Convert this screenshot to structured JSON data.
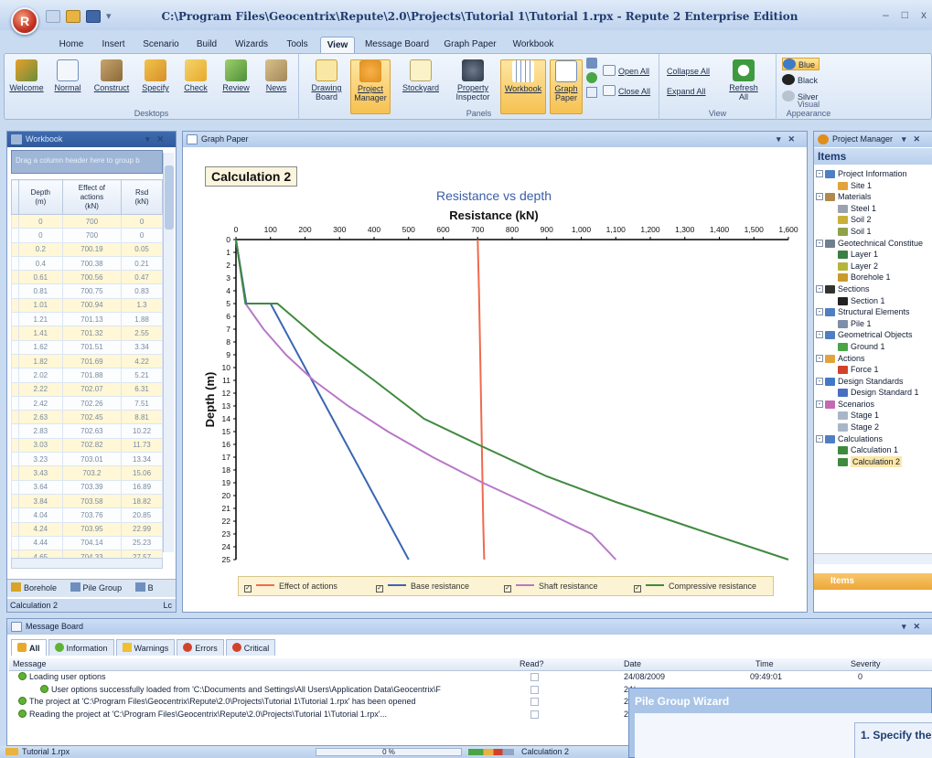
{
  "window": {
    "title": "C:\\Program Files\\Geocentrix\\Repute\\2.0\\Projects\\Tutorial 1\\Tutorial 1.rpx - Repute 2 Enterprise Edition",
    "controls": [
      "–",
      "□",
      "x"
    ]
  },
  "tabs": [
    "Home",
    "Insert",
    "Scenario",
    "Build",
    "Wizards",
    "Tools",
    "View",
    "Message Board",
    "Graph Paper",
    "Workbook"
  ],
  "active_tab": "View",
  "ribbon": {
    "desktops": {
      "label": "Desktops",
      "buttons": [
        "Welcome",
        "Normal",
        "Construct",
        "Specify",
        "Check",
        "Review",
        "News"
      ]
    },
    "panels": {
      "label": "Panels",
      "buttons": [
        {
          "l1": "Drawing",
          "l2": "Board"
        },
        {
          "l1": "Project",
          "l2": "Manager"
        },
        {
          "l1": "Stockyard",
          "l2": ""
        },
        {
          "l1": "Property",
          "l2": "Inspector"
        },
        {
          "l1": "Workbook",
          "l2": ""
        },
        {
          "l1": "Graph",
          "l2": "Paper"
        }
      ],
      "open_all": "Open All",
      "close_all": "Close All"
    },
    "view": {
      "label": "View",
      "collapse_all": "Collapse All",
      "expand_all": "Expand All",
      "refresh": {
        "l1": "Refresh",
        "l2": "All"
      }
    },
    "appearance": {
      "label": "Visual Appearance",
      "options": [
        "Blue",
        "Black",
        "Silver"
      ],
      "selected": "Blue"
    }
  },
  "workbook": {
    "title": "Workbook",
    "group_hint": "Drag a column header here to group b",
    "columns": [
      {
        "l1": "Depth",
        "l2": "(m)",
        "l3": ""
      },
      {
        "l1": "Effect of",
        "l2": "actions",
        "l3": "(kN)"
      },
      {
        "l1": "Rsd",
        "l2": "(kN)",
        "l3": ""
      }
    ],
    "rows": [
      [
        "0",
        "700",
        "0"
      ],
      [
        "0",
        "700",
        "0"
      ],
      [
        "0.2",
        "700.19",
        "0.05"
      ],
      [
        "0.4",
        "700.38",
        "0.21"
      ],
      [
        "0.61",
        "700.56",
        "0.47"
      ],
      [
        "0.81",
        "700.75",
        "0.83"
      ],
      [
        "1.01",
        "700.94",
        "1.3"
      ],
      [
        "1.21",
        "701.13",
        "1.88"
      ],
      [
        "1.41",
        "701.32",
        "2.55"
      ],
      [
        "1.62",
        "701.51",
        "3.34"
      ],
      [
        "1.82",
        "701.69",
        "4.22"
      ],
      [
        "2.02",
        "701.88",
        "5.21"
      ],
      [
        "2.22",
        "702.07",
        "6.31"
      ],
      [
        "2.42",
        "702.26",
        "7.51"
      ],
      [
        "2.63",
        "702.45",
        "8.81"
      ],
      [
        "2.83",
        "702.63",
        "10.22"
      ],
      [
        "3.03",
        "702.82",
        "11.73"
      ],
      [
        "3.23",
        "703.01",
        "13.34"
      ],
      [
        "3.43",
        "703.2",
        "15.06"
      ],
      [
        "3.64",
        "703.39",
        "16.89"
      ],
      [
        "3.84",
        "703.58",
        "18.82"
      ],
      [
        "4.04",
        "703.76",
        "20.85"
      ],
      [
        "4.24",
        "703.95",
        "22.99"
      ],
      [
        "4.44",
        "704.14",
        "25.23"
      ],
      [
        "4.65",
        "704.33",
        "27.57"
      ]
    ],
    "bottom_tabs": [
      "Borehole",
      "Pile Group",
      "B"
    ],
    "status_left": "Calculation 2",
    "status_right": "Lc"
  },
  "graph_paper": {
    "title": "Graph Paper",
    "calc_label": "Calculation 2"
  },
  "chart_data": {
    "type": "line",
    "title": "Resistance vs depth",
    "xlabel": "Resistance (kN)",
    "ylabel": "Depth (m)",
    "xlim": [
      0,
      1600
    ],
    "ylim": [
      0,
      25
    ],
    "y_inverted": true,
    "x_ticks": [
      "0",
      "100",
      "200",
      "300",
      "400",
      "500",
      "600",
      "700",
      "800",
      "900",
      "1,000",
      "1,100",
      "1,200",
      "1,300",
      "1,400",
      "1,500",
      "1,600"
    ],
    "y_ticks": [
      0,
      1,
      2,
      3,
      4,
      5,
      6,
      7,
      8,
      9,
      10,
      11,
      12,
      13,
      14,
      15,
      16,
      17,
      18,
      19,
      20,
      21,
      22,
      23,
      24,
      25
    ],
    "legend_position": "bottom",
    "series": [
      {
        "name": "Effect of actions",
        "color": "#f06a4e",
        "points": [
          [
            700,
            0
          ],
          [
            703.8,
            4
          ],
          [
            708,
            10
          ],
          [
            712,
            16
          ],
          [
            716,
            22
          ],
          [
            719,
            25
          ]
        ]
      },
      {
        "name": "Base resistance",
        "color": "#3a67b2",
        "points": [
          [
            0,
            0
          ],
          [
            30,
            5
          ],
          [
            100,
            5
          ],
          [
            200,
            10
          ],
          [
            300,
            15
          ],
          [
            400,
            20
          ],
          [
            500,
            25
          ]
        ]
      },
      {
        "name": "Shaft resistance",
        "color": "#b878c8",
        "points": [
          [
            0,
            0
          ],
          [
            27.6,
            5
          ],
          [
            80,
            7
          ],
          [
            145,
            9
          ],
          [
            225,
            11
          ],
          [
            325,
            13
          ],
          [
            440,
            15
          ],
          [
            570,
            17
          ],
          [
            715,
            19
          ],
          [
            875,
            21
          ],
          [
            1030,
            23
          ],
          [
            1100,
            25
          ]
        ]
      },
      {
        "name": "Compressive resistance",
        "color": "#3f8a3f",
        "points": [
          [
            0,
            0
          ],
          [
            27.6,
            5
          ],
          [
            120,
            5
          ],
          [
            250,
            8
          ],
          [
            400,
            11
          ],
          [
            545,
            14
          ],
          [
            700,
            16
          ],
          [
            900,
            18.5
          ],
          [
            1100,
            20.5
          ],
          [
            1320,
            22.5
          ],
          [
            1600,
            25
          ]
        ]
      }
    ]
  },
  "project_manager": {
    "title": "Project Manager",
    "items_heading": "Items",
    "tree": [
      {
        "level": 0,
        "label": "Project Information",
        "color": "#4f7fc2",
        "exp": "-"
      },
      {
        "level": 1,
        "label": "Site 1",
        "color": "#e2a43a"
      },
      {
        "level": 0,
        "label": "Materials",
        "color": "#b08a4a",
        "exp": "-"
      },
      {
        "level": 1,
        "label": "Steel 1",
        "color": "#9aa3ad"
      },
      {
        "level": 1,
        "label": "Soil 2",
        "color": "#c9b03a"
      },
      {
        "level": 1,
        "label": "Soil 1",
        "color": "#8fa24a"
      },
      {
        "level": 0,
        "label": "Geotechnical Constitue",
        "color": "#6f7f8f",
        "exp": "-"
      },
      {
        "level": 1,
        "label": "Layer 1",
        "color": "#3d7d46"
      },
      {
        "level": 1,
        "label": "Layer 2",
        "color": "#b4b53c"
      },
      {
        "level": 1,
        "label": "Borehole 1",
        "color": "#c99a2c"
      },
      {
        "level": 0,
        "label": "Sections",
        "color": "#333",
        "exp": "-"
      },
      {
        "level": 1,
        "label": "Section 1",
        "color": "#222"
      },
      {
        "level": 0,
        "label": "Structural Elements",
        "color": "#4f7fc2",
        "exp": "-"
      },
      {
        "level": 1,
        "label": "Pile 1",
        "color": "#7d8ea8"
      },
      {
        "level": 0,
        "label": "Geometrical Objects",
        "color": "#4f7fc2",
        "exp": "-"
      },
      {
        "level": 1,
        "label": "Ground 1",
        "color": "#4aa546"
      },
      {
        "level": 0,
        "label": "Actions",
        "color": "#e2a43a",
        "exp": "-"
      },
      {
        "level": 1,
        "label": "Force 1",
        "color": "#d2422a"
      },
      {
        "level": 0,
        "label": "Design Standards",
        "color": "#3f7ac9",
        "exp": "-"
      },
      {
        "level": 1,
        "label": "Design Standard 1",
        "color": "#4a6fbf"
      },
      {
        "level": 0,
        "label": "Scenarios",
        "color": "#c46ab0",
        "exp": "-"
      },
      {
        "level": 1,
        "label": "Stage 1",
        "color": "#a9b6c7"
      },
      {
        "level": 1,
        "label": "Stage 2",
        "color": "#a9b6c7"
      },
      {
        "level": 0,
        "label": "Calculations",
        "color": "#4f7fc2",
        "exp": "-"
      },
      {
        "level": 1,
        "label": "Calculation 1",
        "color": "#3f8a3f"
      },
      {
        "level": 1,
        "label": "Calculation 2",
        "color": "#3f8a3f"
      }
    ],
    "footer_label": "Items"
  },
  "message_board": {
    "title": "Message Board",
    "tabs": [
      "All",
      "Information",
      "Warnings",
      "Errors",
      "Critical"
    ],
    "columns": [
      "Message",
      "Read?",
      "Date",
      "Time",
      "Severity"
    ],
    "rows": [
      {
        "text": "Loading user options",
        "indent": 1,
        "date": "24/08/2009",
        "time": "09:49:01",
        "severity": "0"
      },
      {
        "text": "User options successfully loaded from 'C:\\Documents and Settings\\All Users\\Application Data\\Geocentrix\\F",
        "indent": 2,
        "date": "24/",
        "time": "",
        "severity": ""
      },
      {
        "text": "The project at 'C:\\Program Files\\Geocentrix\\Repute\\2.0\\Projects\\Tutorial 1\\Tutorial 1.rpx' has been opened",
        "indent": 1,
        "date": "24/",
        "time": "",
        "severity": ""
      },
      {
        "text": "Reading the project at 'C:\\Program Files\\Geocentrix\\Repute\\2.0\\Projects\\Tutorial 1\\Tutorial 1.rpx'...",
        "indent": 1,
        "date": "24/",
        "time": "",
        "severity": ""
      }
    ]
  },
  "wizard": {
    "title": "Pile Group Wizard",
    "step": "1. Specify the"
  },
  "statusbar": {
    "file": "Tutorial 1.rpx",
    "progress": "0 %",
    "calc": "Calculation 2"
  }
}
